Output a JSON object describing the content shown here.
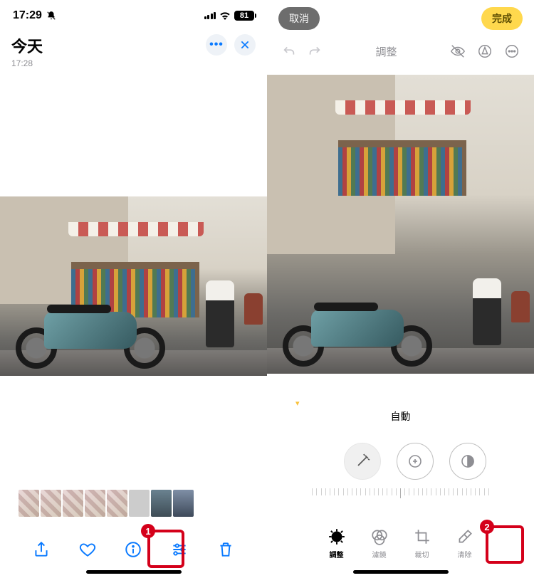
{
  "left": {
    "statusTime": "17:29",
    "batteryPct": "81",
    "title": "今天",
    "subtitle": "17:28"
  },
  "right": {
    "cancel": "取消",
    "done": "完成",
    "tabAdjustTop": "調整",
    "autoLabel": "自動",
    "tabs": {
      "adjust": "調整",
      "filters": "濾鏡",
      "crop": "裁切",
      "cleanup": "清除"
    }
  },
  "badges": {
    "one": "1",
    "two": "2"
  }
}
